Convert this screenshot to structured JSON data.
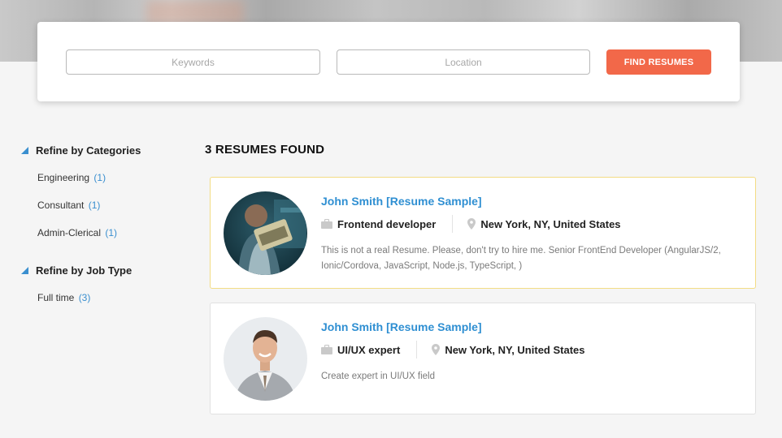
{
  "search": {
    "keywords_placeholder": "Keywords",
    "location_placeholder": "Location",
    "button_label": "FIND RESUMES"
  },
  "sidebar": {
    "categories_heading": "Refine by Categories",
    "categories": [
      {
        "label": "Engineering",
        "count": "(1)"
      },
      {
        "label": "Consultant",
        "count": "(1)"
      },
      {
        "label": "Admin-Clerical",
        "count": "(1)"
      }
    ],
    "job_type_heading": "Refine by Job Type",
    "job_types": [
      {
        "label": "Full time",
        "count": "(3)"
      }
    ]
  },
  "results": {
    "title": "3 RESUMES FOUND",
    "items": [
      {
        "name": "John Smith [Resume Sample]",
        "role": "Frontend developer",
        "location": "New York, NY, United States",
        "description": "This is not a real Resume. Please, don't try to hire me. Senior FrontEnd Developer (AngularJS/2, Ionic/Cordova, JavaScript, Node.js, TypeScript, )",
        "avatar_icon": "person-with-laptop-photo",
        "featured": true
      },
      {
        "name": "John Smith [Resume Sample]",
        "role": "UI/UX expert",
        "location": "New York, NY, United States",
        "description": "Create expert in UI/UX field",
        "avatar_icon": "businessman-portrait-photo",
        "featured": false
      }
    ]
  },
  "colors": {
    "accent_blue": "#2f8fd2",
    "button_orange": "#f26849",
    "featured_border": "#f3dc84"
  }
}
